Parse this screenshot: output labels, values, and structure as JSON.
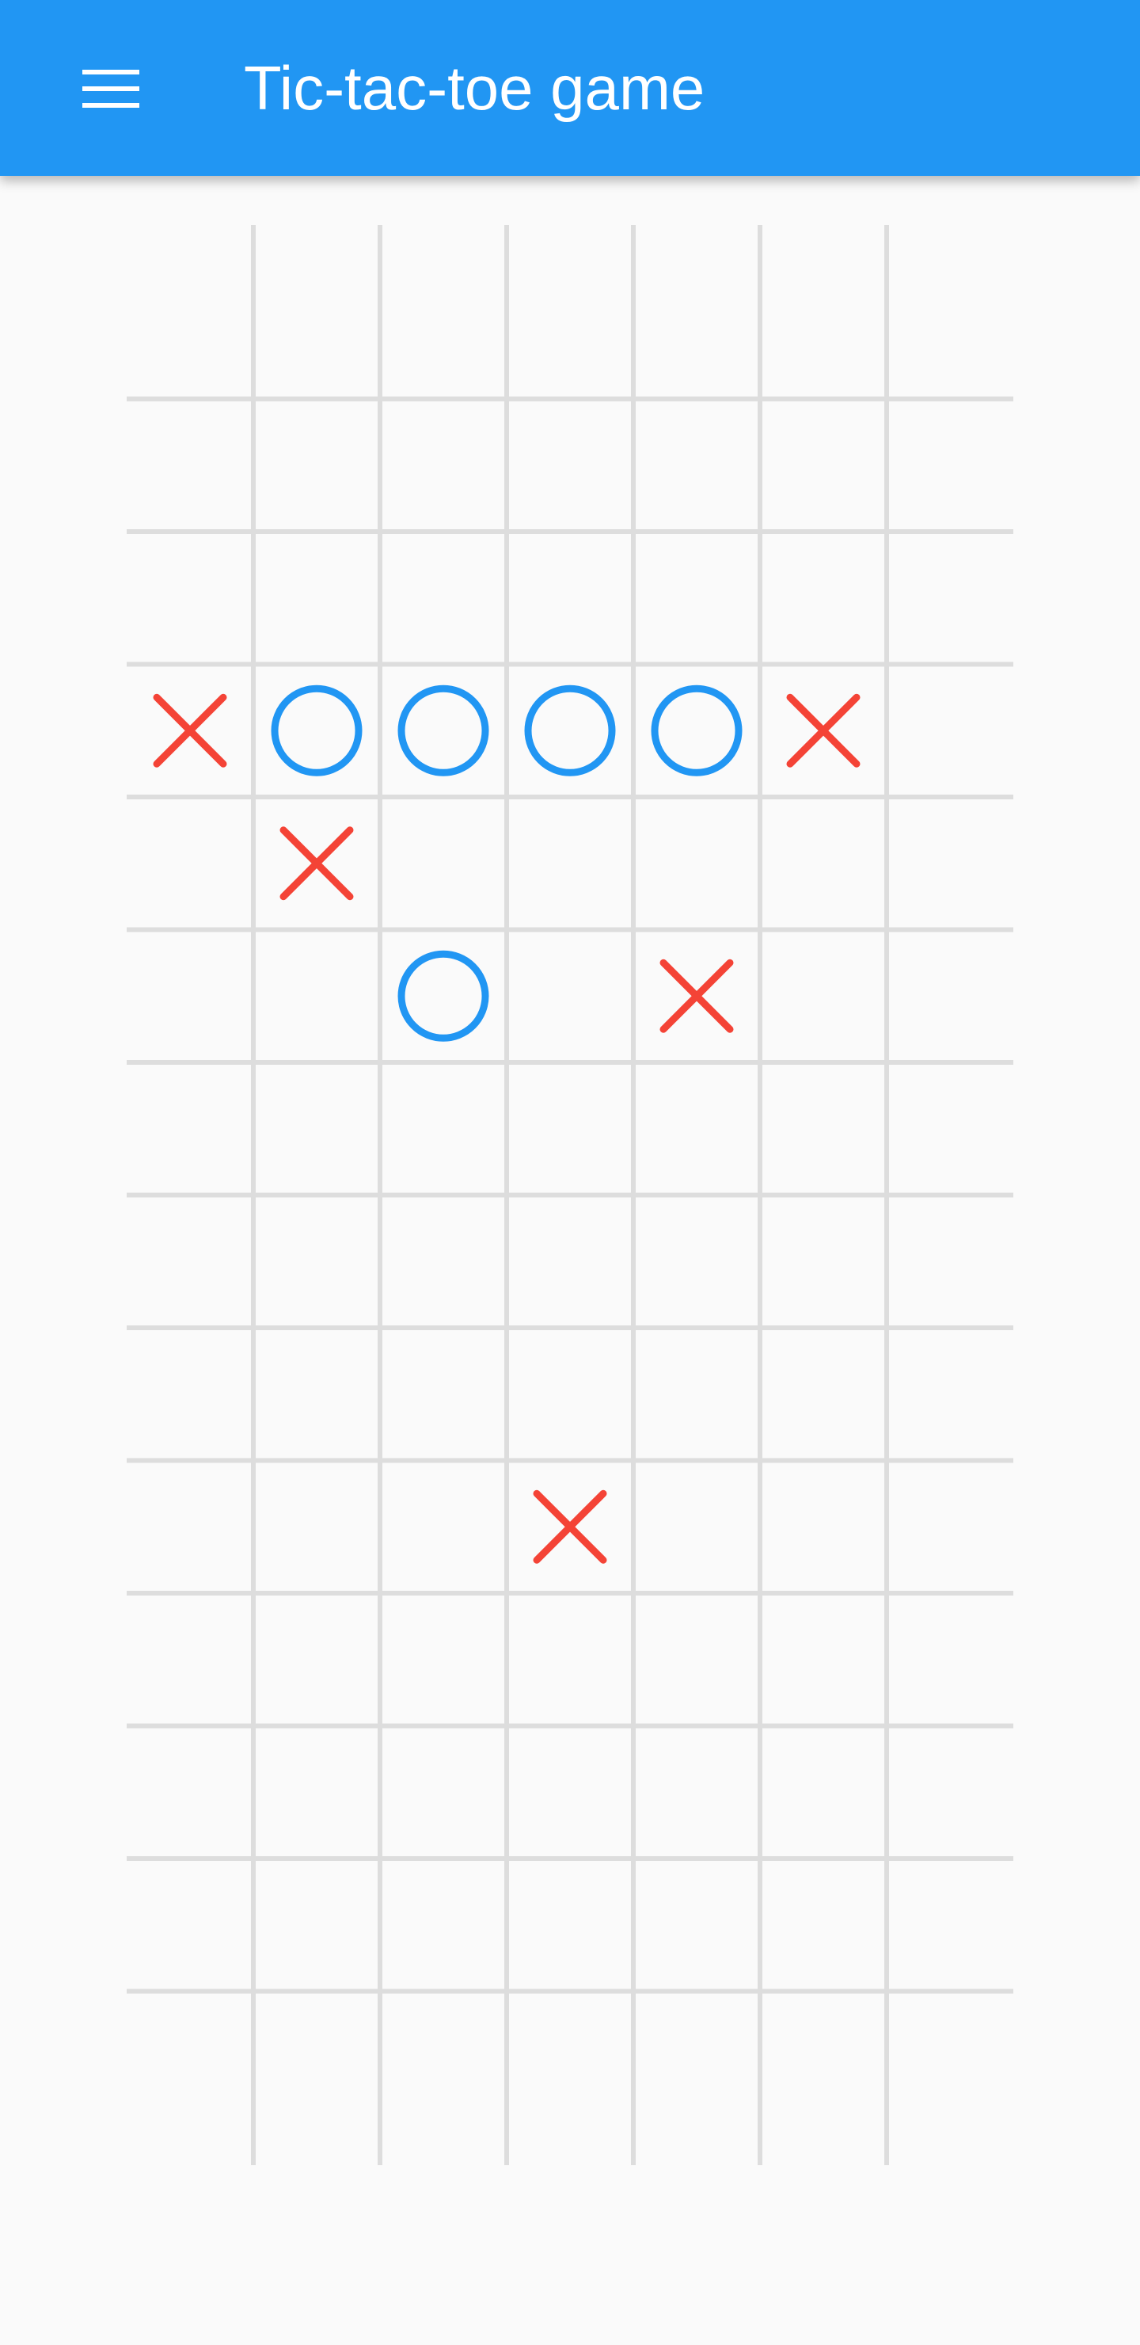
{
  "app": {
    "title": "Tic-tac-toe game"
  },
  "icons": {
    "menu": "menu-icon"
  },
  "colors": {
    "app_bar": "#2196f3",
    "background": "#fafafa",
    "grid_line": "#dddddd",
    "x_mark": "#f44336",
    "o_mark": "#2196f3",
    "title_text": "#ffffff"
  },
  "board": {
    "columns": 7,
    "rows": 14,
    "moves": [
      {
        "row": 3,
        "col": 0,
        "mark": "X"
      },
      {
        "row": 3,
        "col": 1,
        "mark": "O"
      },
      {
        "row": 3,
        "col": 2,
        "mark": "O"
      },
      {
        "row": 3,
        "col": 3,
        "mark": "O"
      },
      {
        "row": 3,
        "col": 4,
        "mark": "O"
      },
      {
        "row": 3,
        "col": 5,
        "mark": "X"
      },
      {
        "row": 4,
        "col": 1,
        "mark": "X"
      },
      {
        "row": 5,
        "col": 2,
        "mark": "O"
      },
      {
        "row": 5,
        "col": 4,
        "mark": "X"
      },
      {
        "row": 9,
        "col": 3,
        "mark": "X"
      }
    ]
  }
}
